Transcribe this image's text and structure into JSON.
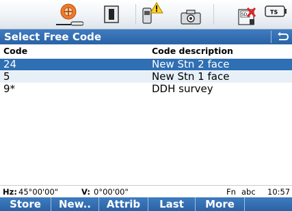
{
  "title": "Select Free Code",
  "columns": {
    "code": "Code",
    "description": "Code description"
  },
  "rows": [
    {
      "code": "24",
      "description": "New Stn 2 face",
      "selected": true
    },
    {
      "code": "5",
      "description": "New Stn 1 face",
      "selected": false
    },
    {
      "code": "9*",
      "description": "DDH survey",
      "selected": false
    }
  ],
  "status": {
    "hz_label": "Hz:",
    "hz_value": "45°00'00\"",
    "v_label": "V:",
    "v_value": "0°00'00\"",
    "fn": "Fn",
    "mode": "abc",
    "time": "10:57"
  },
  "softkeys": [
    "Store",
    "New..",
    "Attrib",
    "Last",
    "More"
  ],
  "icons": {
    "topbar": [
      "prism-icon",
      "input-mode-icon",
      "instrument-warning-icon",
      "camera-icon",
      "sd-card-icon",
      "ts-battery-icon"
    ],
    "back": "back-arrow-icon"
  },
  "colors": {
    "title_bar": "#2a63a6",
    "selection": "#2f6fb3",
    "alt_row": "#e7f0f7"
  }
}
